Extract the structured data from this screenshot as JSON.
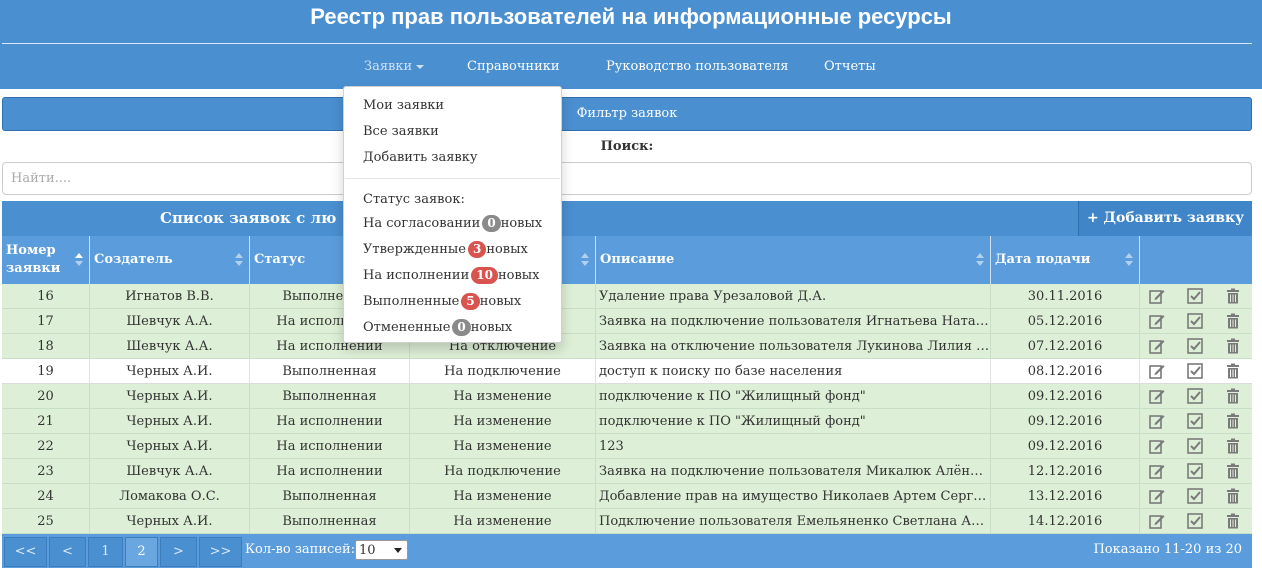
{
  "app": {
    "title": "Реестр прав пользователей на информационные ресурсы"
  },
  "nav": [
    {
      "label": "Заявки",
      "active": true
    },
    {
      "label": "Справочники"
    },
    {
      "label": "Руководство пользователя"
    },
    {
      "label": "Отчеты"
    }
  ],
  "dropdown": {
    "items": [
      "Мои заявки",
      "Все заявки",
      "Добавить заявку"
    ],
    "status_heading": "Статус заявок:",
    "statuses": [
      {
        "label": "На согласовании",
        "count": "0",
        "suffix": "новых",
        "badge_color": "#8a8a8a"
      },
      {
        "label": "Утвержденные",
        "count": "3",
        "suffix": "новых",
        "badge_color": "#d9534f"
      },
      {
        "label": "На исполнении",
        "count": "10",
        "suffix": "новых",
        "badge_color": "#d9534f"
      },
      {
        "label": "Выполненные",
        "count": "5",
        "suffix": "новых",
        "badge_color": "#d9534f"
      },
      {
        "label": "Отмененные",
        "count": "0",
        "suffix": "новых",
        "badge_color": "#8a8a8a"
      }
    ]
  },
  "filter": {
    "label": "Фильтр заявок"
  },
  "search": {
    "label": "Поиск:",
    "placeholder": "Найти...."
  },
  "list": {
    "title": "Список заявок с лю",
    "add_label": "+ Добавить заявку"
  },
  "columns": [
    "Номер заявки",
    "Создатель",
    "Статус",
    "",
    "Описание",
    "Дата подачи"
  ],
  "rows": [
    {
      "num": "16",
      "creator": "Игнатов В.В.",
      "status": "Выполненная",
      "type": "",
      "desc": "Удаление права Урезаловой Д.А.",
      "date": "30.11.2016",
      "highlight": true
    },
    {
      "num": "17",
      "creator": "Шевчук А.А.",
      "status": "На исполнении",
      "type": "",
      "desc": "Заявка на подключение пользователя Игнатьева Наталь...",
      "date": "05.12.2016",
      "highlight": true
    },
    {
      "num": "18",
      "creator": "Шевчук А.А.",
      "status": "На исполнении",
      "type": "На отключение",
      "desc": "Заявка на отключение пользователя Лукинова Лилия И...",
      "date": "07.12.2016",
      "highlight": true
    },
    {
      "num": "19",
      "creator": "Черных А.И.",
      "status": "Выполненная",
      "type": "На подключение",
      "desc": "доступ к поиску по базе населения",
      "date": "08.12.2016",
      "highlight": false
    },
    {
      "num": "20",
      "creator": "Черных А.И.",
      "status": "Выполненная",
      "type": "На изменение",
      "desc": "подключение к ПО \"Жилищный фонд\"",
      "date": "09.12.2016",
      "highlight": true
    },
    {
      "num": "21",
      "creator": "Черных А.И.",
      "status": "На исполнении",
      "type": "На изменение",
      "desc": "подключение к ПО \"Жилищный фонд\"",
      "date": "09.12.2016",
      "highlight": true
    },
    {
      "num": "22",
      "creator": "Черных А.И.",
      "status": "На исполнении",
      "type": "На изменение",
      "desc": "123",
      "date": "09.12.2016",
      "highlight": true
    },
    {
      "num": "23",
      "creator": "Шевчук А.А.",
      "status": "На исполнении",
      "type": "На подключение",
      "desc": "Заявка на подключение пользователя Микалюк Алёна Е...",
      "date": "12.12.2016",
      "highlight": true
    },
    {
      "num": "24",
      "creator": "Ломакова О.С.",
      "status": "Выполненная",
      "type": "На изменение",
      "desc": "Добавление прав на имущество Николаев Артем Сергеев...",
      "date": "13.12.2016",
      "highlight": true
    },
    {
      "num": "25",
      "creator": "Черных А.И.",
      "status": "Выполненная",
      "type": "На изменение",
      "desc": "Подключение пользователя Емельяненко Светлана Анд...",
      "date": "14.12.2016",
      "highlight": true
    }
  ],
  "pager": {
    "buttons": [
      {
        "label": "<<"
      },
      {
        "label": "<"
      },
      {
        "label": "1"
      },
      {
        "label": "2",
        "active": true
      },
      {
        "label": ">"
      },
      {
        "label": ">>"
      }
    ],
    "count_label": "Кол-во записей:",
    "page_size": "10",
    "info": "Показано 11-20 из 20"
  },
  "colors": {
    "accent": "#4a8fd0",
    "row_highlight": "#ddefd6",
    "badge_red": "#d9534f",
    "badge_gray": "#8a8a8a"
  }
}
